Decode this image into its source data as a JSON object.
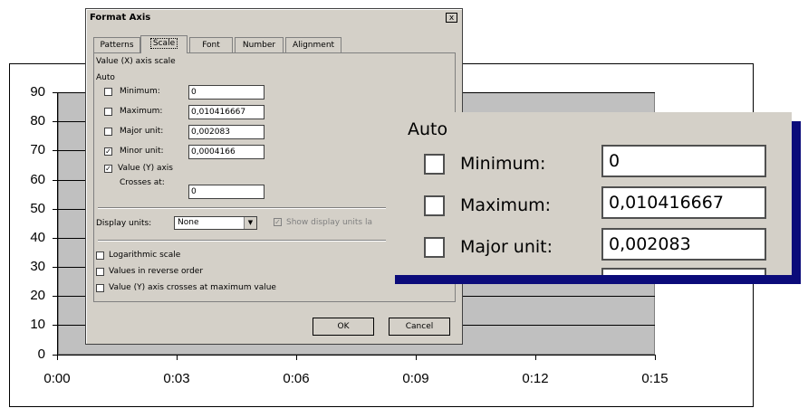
{
  "chart": {
    "y_ticks": [
      "90",
      "80",
      "70",
      "60",
      "50",
      "40",
      "30",
      "20",
      "10",
      "0"
    ],
    "x_ticks": [
      "0:00",
      "0:03",
      "0:06",
      "0:09",
      "0:12",
      "0:15"
    ]
  },
  "dialog": {
    "title": "Format Axis",
    "close_label": "x",
    "tabs": [
      "Patterns",
      "Scale",
      "Font",
      "Number",
      "Alignment"
    ],
    "active_tab": "Scale",
    "heading": "Value (X) axis scale",
    "auto_label": "Auto",
    "rows": [
      {
        "label": "Minimum:",
        "value": "0",
        "checked": false
      },
      {
        "label": "Maximum:",
        "value": "0,010416667",
        "checked": false
      },
      {
        "label": "Major unit:",
        "value": "0,002083",
        "checked": false
      },
      {
        "label": "Minor unit:",
        "value": "0,0004166",
        "checked": true
      }
    ],
    "value_axis_label": "Value (Y) axis",
    "value_axis_checked": true,
    "crosses_label": "Crosses at:",
    "crosses_value": "0",
    "display_units_label": "Display units:",
    "display_units_value": "None",
    "show_units_label": "Show display units la",
    "log_scale_label": "Logarithmic scale",
    "reverse_label": "Values in reverse order",
    "crosses_max_label": "Value (Y) axis crosses at maximum value",
    "ok_label": "OK",
    "cancel_label": "Cancel"
  },
  "zoom": {
    "auto_label": "Auto",
    "rows": [
      {
        "label": "Minimum:",
        "value": "0"
      },
      {
        "label": "Maximum:",
        "value": "0,010416667"
      },
      {
        "label": "Major unit:",
        "value": "0,002083"
      }
    ]
  }
}
